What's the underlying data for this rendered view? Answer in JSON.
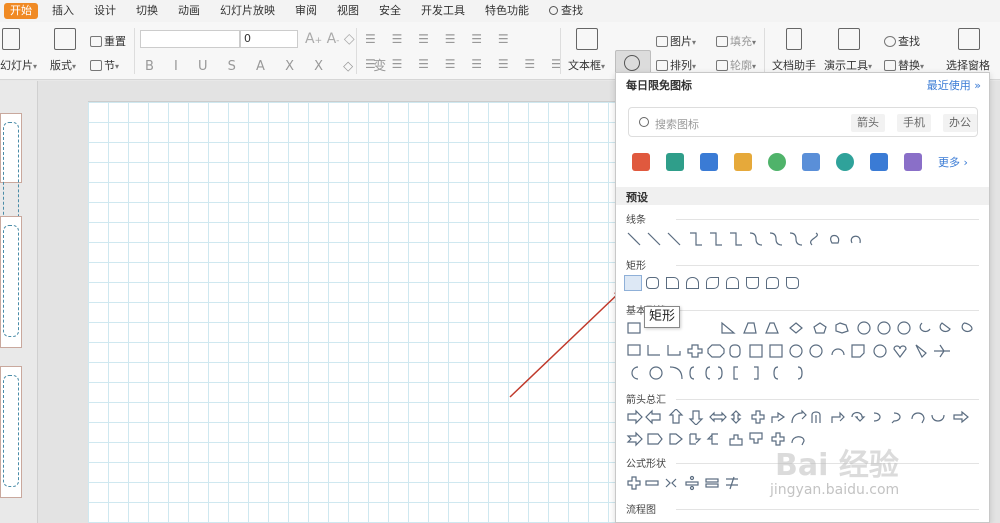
{
  "menu": {
    "items": [
      "开始",
      "插入",
      "设计",
      "切换",
      "动画",
      "幻灯片放映",
      "审阅",
      "视图",
      "安全",
      "开发工具",
      "特色功能"
    ],
    "search_label": "查找"
  },
  "ribbon": {
    "new_slide": "幻灯片",
    "layout": "版式",
    "reset": "重置",
    "section": "节",
    "font_size": "0",
    "textbox": "文本框",
    "shape": "形状",
    "picture": "图片",
    "fill": "填充",
    "arrange": "排列",
    "outline": "轮廓",
    "doc_helper": "文档助手",
    "present_tool": "演示工具",
    "find": "查找",
    "replace": "替换",
    "select_pane": "选择窗格"
  },
  "dropdown": {
    "title": "每日限免图标",
    "recent": "最近使用",
    "search_placeholder": "搜索图标",
    "tags": [
      "箭头",
      "手机",
      "办公"
    ],
    "more": "更多",
    "preset": "预设",
    "categories": [
      "线条",
      "矩形",
      "基本形状",
      "箭头总汇",
      "公式形状",
      "流程图"
    ],
    "tooltip": "矩形"
  },
  "watermark": {
    "brand": "Bai 经验",
    "url": "jingyan.baidu.com"
  },
  "colors": {
    "accent": "#f08a24",
    "link": "#3a7bd5",
    "grid": "#cfe8f0",
    "arrow": "#c0392b"
  }
}
